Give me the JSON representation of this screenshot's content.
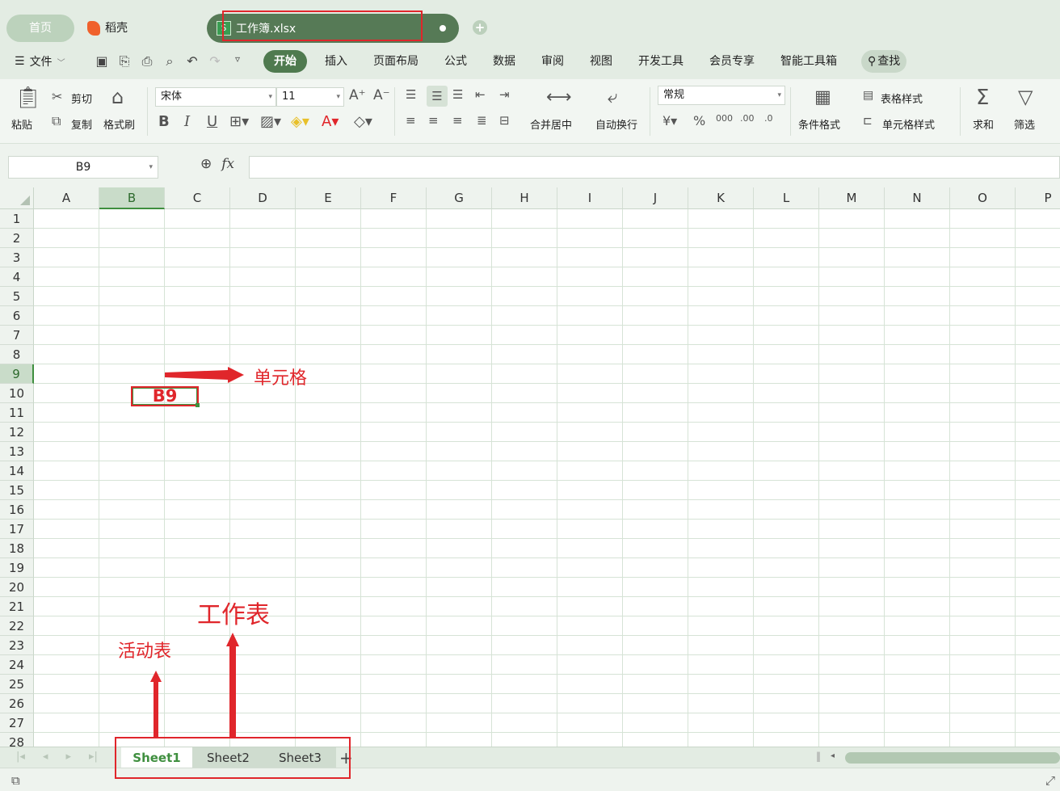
{
  "titlebar": {
    "home_tab": "首页",
    "daoke_tab": "稻壳",
    "doc_tab": "工作簿.xlsx",
    "doc_icon_letter": "S"
  },
  "menubar": {
    "file_label": "文件",
    "tabs": [
      "开始",
      "插入",
      "页面布局",
      "公式",
      "数据",
      "审阅",
      "视图",
      "开发工具",
      "会员专享",
      "智能工具箱"
    ],
    "search_label": "查找"
  },
  "ribbon": {
    "paste": "粘贴",
    "cut": "剪切",
    "copy": "复制",
    "format_painter": "格式刷",
    "font_name": "宋体",
    "font_size": "11",
    "number_format": "常规",
    "merge_center": "合并居中",
    "wrap_text": "自动换行",
    "table_style": "表格样式",
    "cell_style": "单元格样式",
    "conditional_format": "条件格式",
    "sum": "求和",
    "filter": "筛选"
  },
  "formula_bar": {
    "name_box": "B9",
    "fx_label": "fx",
    "formula_value": ""
  },
  "grid": {
    "columns": [
      "A",
      "B",
      "C",
      "D",
      "E",
      "F",
      "G",
      "H",
      "I",
      "J",
      "K",
      "L",
      "M",
      "N",
      "O",
      "P"
    ],
    "rows": [
      "1",
      "2",
      "3",
      "4",
      "5",
      "6",
      "7",
      "8",
      "9",
      "10",
      "11",
      "12",
      "13",
      "14",
      "15",
      "16",
      "17",
      "18",
      "19",
      "20",
      "21",
      "22",
      "23",
      "24",
      "25",
      "26",
      "27",
      "28"
    ],
    "selected_column": "B",
    "selected_row": "9",
    "cell_b9_text": "B9"
  },
  "sheets": {
    "tabs": [
      "Sheet1",
      "Sheet2",
      "Sheet3"
    ],
    "active": "Sheet1",
    "add_label": "+"
  },
  "annotations": {
    "cell_label": "单元格",
    "worksheet_label": "工作表",
    "active_sheet_label": "活动表",
    "color": "#e0262b"
  }
}
